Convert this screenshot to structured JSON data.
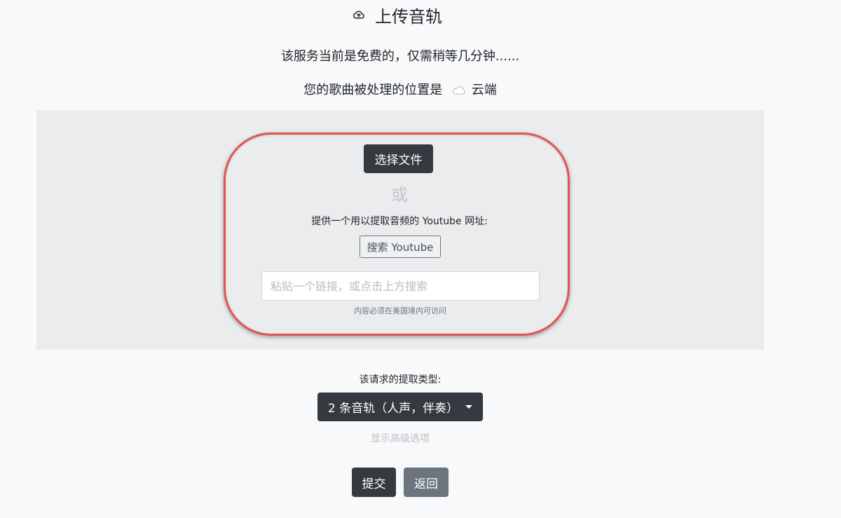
{
  "header": {
    "title": "上传音轨",
    "icon": "cloud-upload-icon"
  },
  "intro": {
    "line1": "该服务当前是免费的，仅需稍等几分钟......",
    "line2_prefix": "您的歌曲被处理的位置是",
    "line2_location": "云端",
    "location_icon": "cloud-icon"
  },
  "upload": {
    "choose_file_label": "选择文件",
    "or_text": "或",
    "youtube_prompt": "提供一个用以提取音频的 Youtube 网址:",
    "search_youtube_label": "搜索 Youtube",
    "url_placeholder": "粘贴一个链接，或点击上方搜索",
    "url_value": "",
    "url_help": "内容必须在美国境内可访问"
  },
  "extraction": {
    "label": "该请求的提取类型:",
    "selected": "2 条音轨（人声，伴奏）",
    "advanced_link": "显示高级选项"
  },
  "actions": {
    "submit_label": "提交",
    "back_label": "返回"
  },
  "colors": {
    "background": "#f8f9fa",
    "panel": "#ebecee",
    "dark_button": "#343a40",
    "secondary_button": "#6c757d",
    "highlight_ring": "#e0554f"
  }
}
